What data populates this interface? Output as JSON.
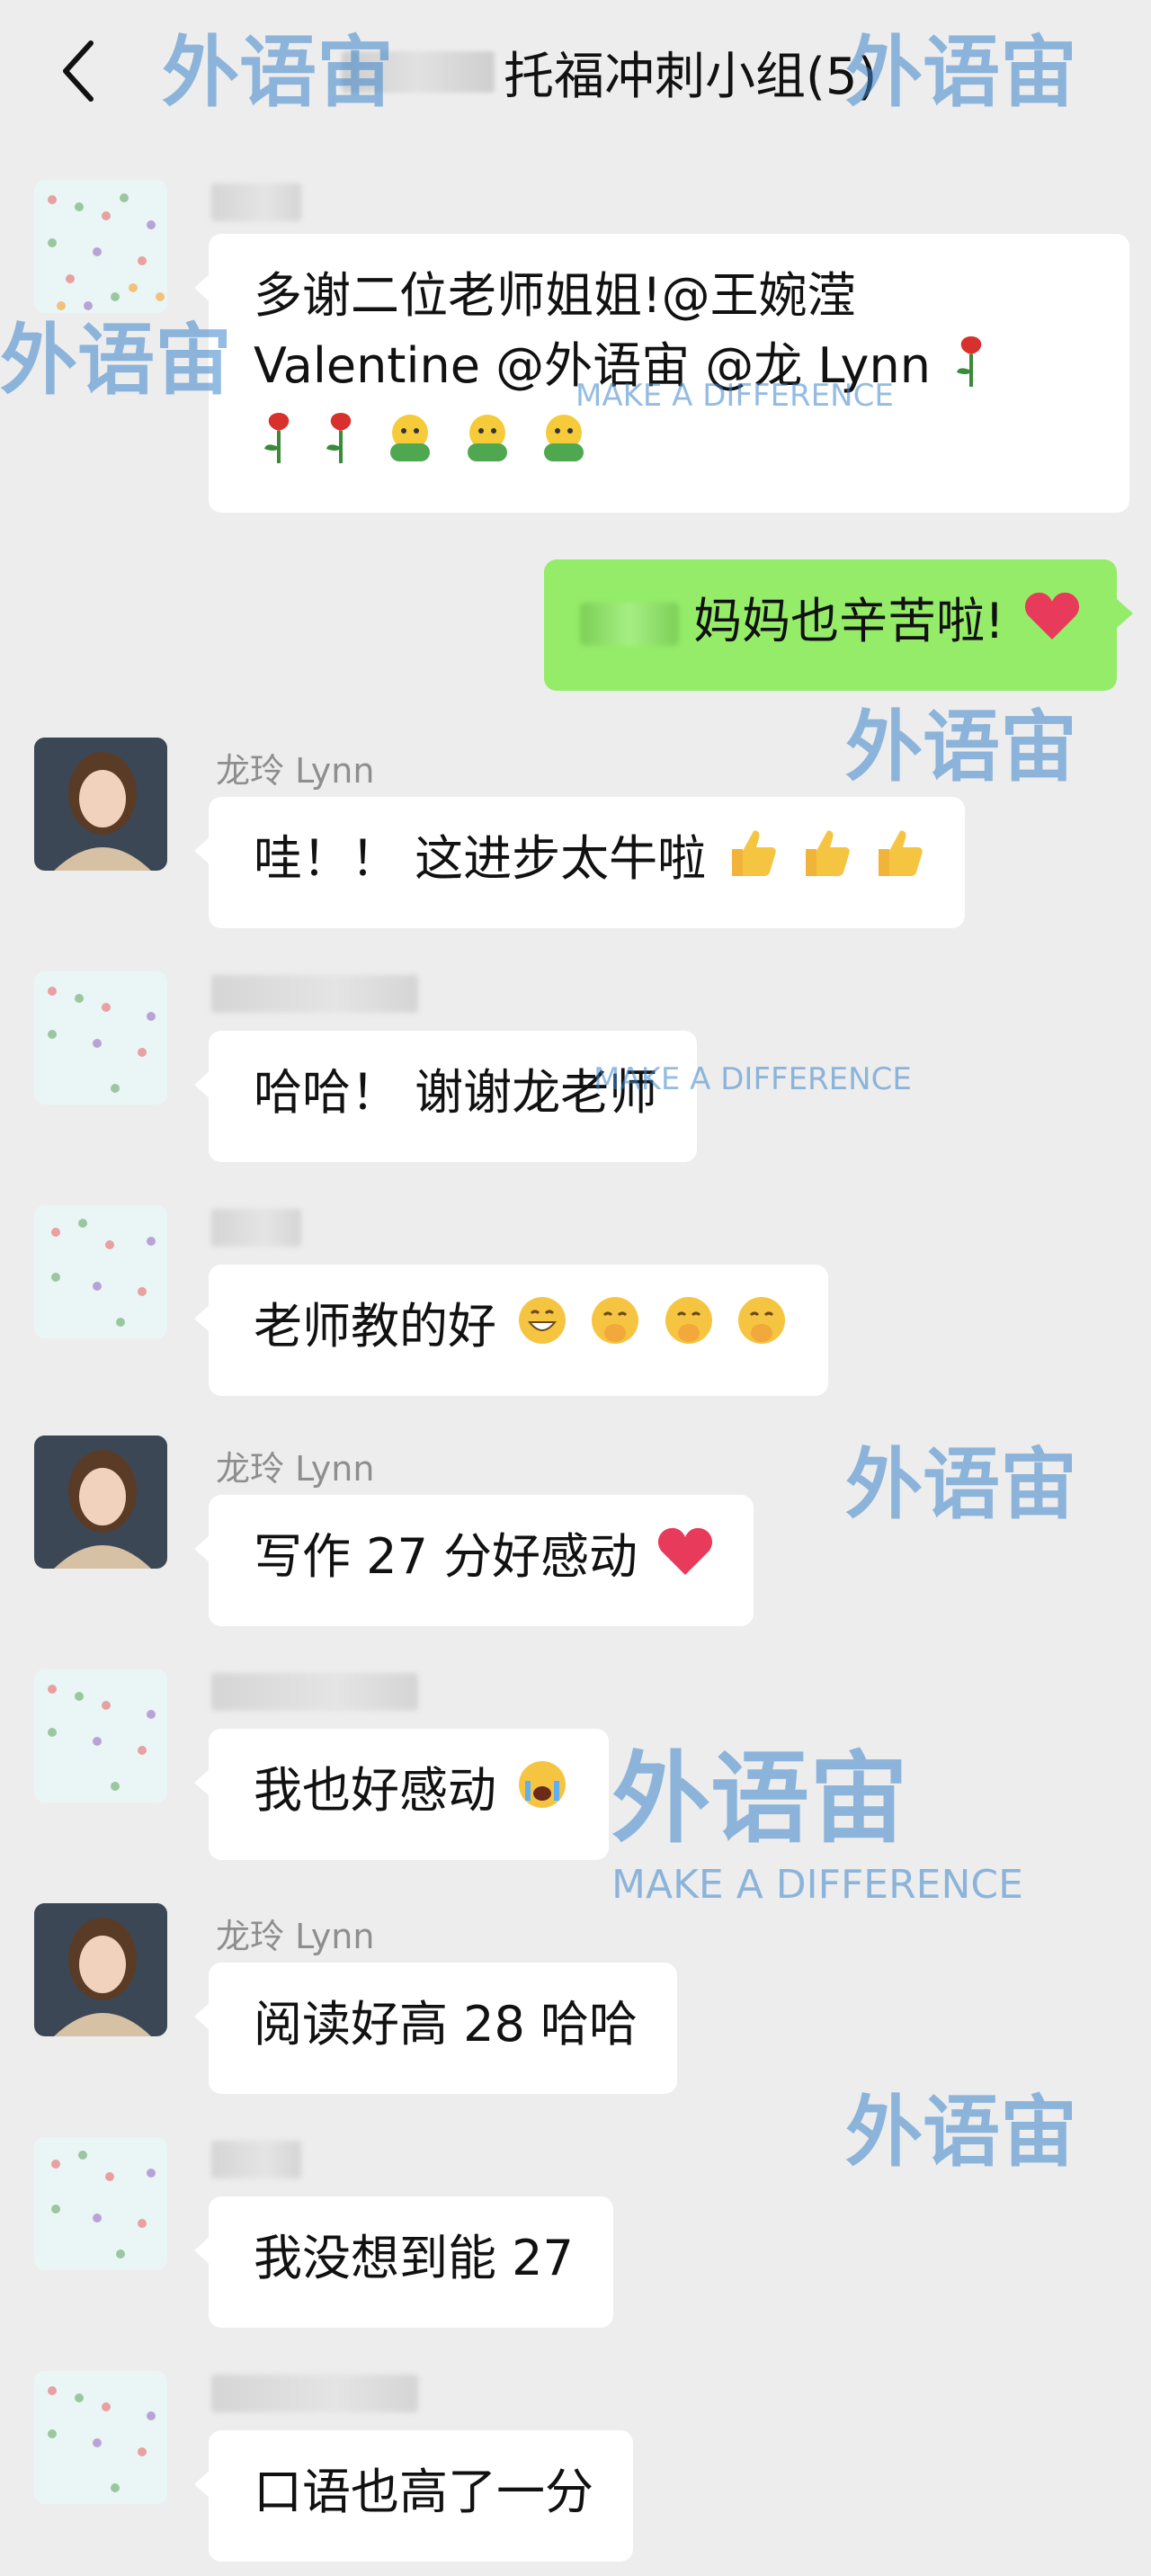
{
  "header": {
    "back_icon": "chevron-left-icon",
    "title": "托福冲刺小组(5)"
  },
  "messages": [
    {
      "sender": "",
      "text_lines": [
        "多谢二位老师姐姐!@王婉滢",
        "Valentine @外语宙  @龙 Lynn"
      ]
    },
    {
      "sender": "me",
      "text": "妈妈也辛苦啦!"
    },
    {
      "sender": "龙玲 Lynn",
      "text": "哇！！ 这进步太牛啦"
    },
    {
      "sender": "",
      "text": "哈哈！ 谢谢龙老师"
    },
    {
      "sender": "",
      "text": "老师教的好"
    },
    {
      "sender": "龙玲 Lynn",
      "text": "写作 27 分好感动"
    },
    {
      "sender": "",
      "text": "我也好感动"
    },
    {
      "sender": "龙玲 Lynn",
      "text": "阅读好高 28 哈哈"
    },
    {
      "sender": "",
      "text": "我没想到能 27"
    },
    {
      "sender": "",
      "text": "口语也高了一分"
    }
  ],
  "watermark": {
    "brand": "外语宙",
    "slogan": "MAKE A DIFFERENCE"
  },
  "colors": {
    "background": "#ededed",
    "my_bubble": "#95ec69",
    "other_bubble": "#ffffff",
    "watermark": "#3d86cc"
  }
}
